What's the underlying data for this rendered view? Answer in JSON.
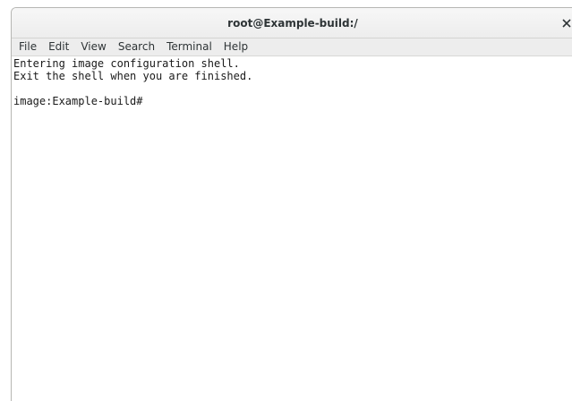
{
  "window": {
    "title": "root@Example-build:/",
    "close_icon": "close-icon"
  },
  "menu": {
    "items": [
      "File",
      "Edit",
      "View",
      "Search",
      "Terminal",
      "Help"
    ]
  },
  "terminal": {
    "lines": [
      "Entering image configuration shell.",
      "Exit the shell when you are finished.",
      "",
      "image:Example-build#"
    ]
  },
  "colors": {
    "background": "#ffffff",
    "titlebar": "#ededed",
    "text": "#2e3436"
  }
}
